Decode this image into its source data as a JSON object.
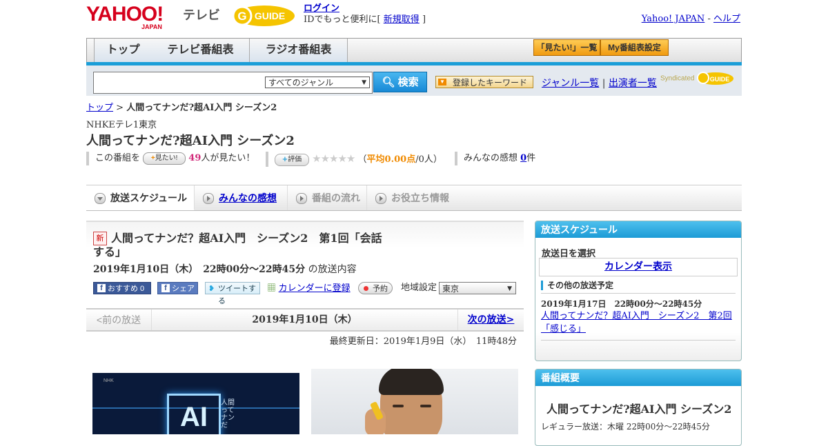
{
  "header": {
    "logo_text": "YAHOO!",
    "logo_sub": "JAPAN",
    "service": "テレビ",
    "gguide": "G-GUIDE",
    "login": "ログイン",
    "login_note_pre": "IDでもっと便利に[",
    "signup": "新規取得",
    "login_note_post": "]",
    "yahoo_japan": "Yahoo! JAPAN",
    "sep": " - ",
    "help": "ヘルプ"
  },
  "nav": {
    "tabs": [
      "トップ",
      "テレビ番組表",
      "ラジオ番組表"
    ],
    "mitai_list": "「見たい!」一覧",
    "my_bangumi": "My番組表設定"
  },
  "search": {
    "genre": "すべてのジャンル",
    "button": "検索",
    "keyword_btn": "登録したキーワード",
    "genre_list": "ジャンル一覧",
    "divider": "|",
    "performer_list": "出演者一覧",
    "syndicated": "Syndicated"
  },
  "breadcrumb": {
    "top": "トップ",
    "sep": " > ",
    "current": "人間ってナンだ?超AI入門 シーズン2"
  },
  "program": {
    "station": "NHKEテレ1東京",
    "title": "人間ってナンだ?超AI入門 シーズン2",
    "mitai_pre": "この番組を",
    "mitai_btn": "見たい!",
    "mitai_count": "49",
    "mitai_post": "人が見たい！",
    "hyoka_btn": "評価",
    "stars": "★★★★★",
    "avg_pre": "（",
    "avg_label": "平均0.00点",
    "avg_post": "/0人）",
    "kanso_pre": "みんなの感想",
    "kanso_count": "0",
    "kanso_post": "件"
  },
  "content_tabs": [
    "放送スケジュール",
    "みんなの感想",
    "番組の流れ",
    "お役立ち情報"
  ],
  "episode": {
    "new_badge": "新",
    "title": "人間ってナンだ？超AI入門　シーズン2　第1回「会話する」",
    "date": "2019年1月10日（木）　22時00分～22時45分",
    "date_suffix": "の放送内容",
    "fb_recommend": "おすすめ 0",
    "fb_share": "シェア",
    "tweet": "ツイートする",
    "calendar": "カレンダーに登録",
    "reserve": "予約",
    "area_label": "地域設定",
    "area_value": "東京"
  },
  "pager": {
    "prev": "<前の放送",
    "current": "2019年1月10日（木）",
    "next": "次の放送>"
  },
  "updated": "最終更新日：2019年1月9日（水）　11時48分",
  "images": {
    "img1_ai": "AI",
    "img1_side": "人間ってナンだ",
    "img1_nhk": "NHK"
  },
  "schedule_box": {
    "title": "放送スケジュール",
    "select_label": "放送日を選択",
    "calendar_link": "カレンダー表示",
    "other_label": "その他の放送予定",
    "other_date": "2019年1月17日　22時00分～22時45分",
    "other_link": "人間ってナンだ？超AI入門　シーズン2　第2回「感じる」"
  },
  "overview_box": {
    "title": "番組概要",
    "program_title": "人間ってナンだ?超AI入門 シーズン2",
    "regular": "レギュラー放送：木曜 22時00分～22時45分"
  },
  "colors": {
    "yahoo_red": "#d6001c",
    "accent_blue": "#1a9ed8",
    "link": "#0000cc",
    "pink": "#d12a7a",
    "orange": "#f08a00"
  }
}
